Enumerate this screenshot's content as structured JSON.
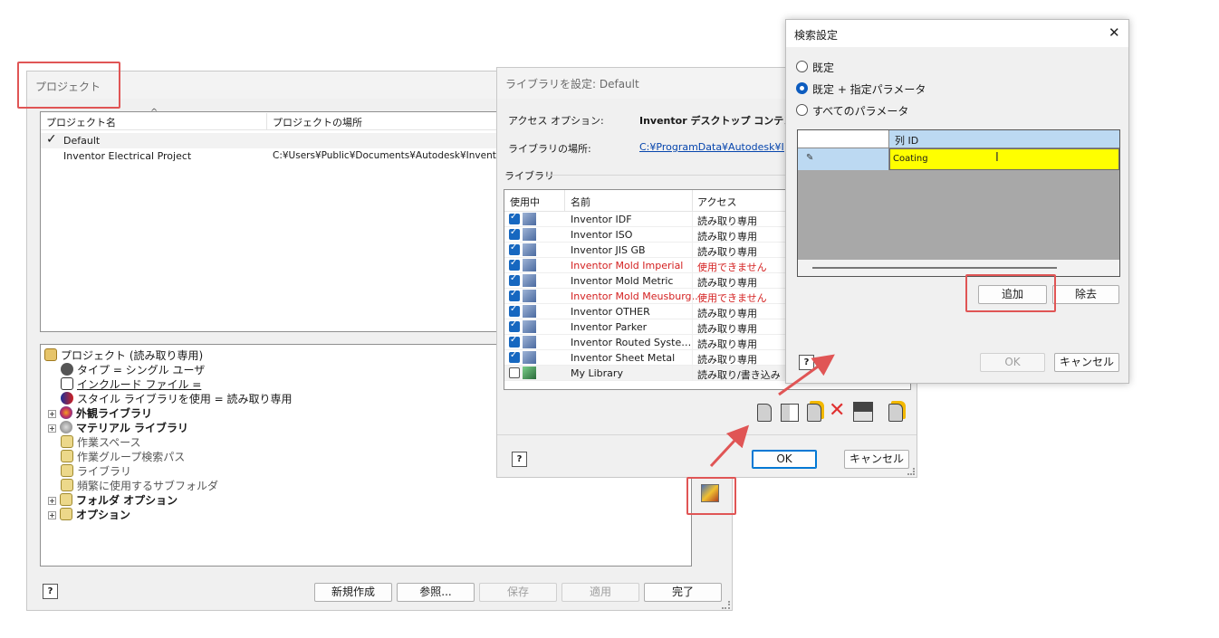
{
  "project_dialog": {
    "title": "プロジェクト",
    "columns": [
      "プロジェクト名",
      "プロジェクトの場所"
    ],
    "projects": [
      {
        "check": "✓",
        "name": "Default",
        "location": ""
      },
      {
        "check": "",
        "name": "Inventor Electrical Project",
        "location": "C:¥Users¥Public¥Documents¥Autodesk¥Inventor"
      }
    ],
    "tree": {
      "root": "プロジェクト (読み取り専用)",
      "type": "タイプ = シングル ユーザ",
      "include": "インクルード ファイル =",
      "style": "スタイル ライブラリを使用 = 読み取り専用",
      "appearance": "外観ライブラリ",
      "material": "マテリアル ライブラリ",
      "workspace": "作業スペース",
      "workgroup": "作業グループ検索パス",
      "libraries": "ライブラリ",
      "subfolders": "頻繁に使用するサブフォルダ",
      "folder_options": "フォルダ オプション",
      "options": "オプション"
    },
    "buttons": {
      "new": "新規作成",
      "browse": "参照...",
      "save": "保存",
      "apply": "適用",
      "done": "完了"
    }
  },
  "library_dialog": {
    "title": "ライブラリを設定: Default",
    "access_label": "アクセス オプション:",
    "access_value": "Inventor デスクトップ コンテンツ",
    "location_label": "ライブラリの場所:",
    "location_value": "C:¥ProgramData¥Autodesk¥Inve",
    "group_label": "ライブラリ",
    "columns": [
      "使用中",
      "名前",
      "アクセス"
    ],
    "rows": [
      {
        "checked": true,
        "name": "Inventor IDF",
        "access": "読み取り専用",
        "error": false
      },
      {
        "checked": true,
        "name": "Inventor ISO",
        "access": "読み取り専用",
        "error": false
      },
      {
        "checked": true,
        "name": "Inventor JIS GB",
        "access": "読み取り専用",
        "error": false
      },
      {
        "checked": true,
        "name": "Inventor Mold Imperial",
        "access": "使用できません",
        "error": true
      },
      {
        "checked": true,
        "name": "Inventor Mold Metric",
        "access": "読み取り専用",
        "error": false
      },
      {
        "checked": true,
        "name": "Inventor Mold Meusburg…",
        "access": "使用できません",
        "error": true
      },
      {
        "checked": true,
        "name": "Inventor OTHER",
        "access": "読み取り専用",
        "error": false
      },
      {
        "checked": true,
        "name": "Inventor Parker",
        "access": "読み取り専用",
        "error": false
      },
      {
        "checked": true,
        "name": "Inventor Routed Syste…",
        "access": "読み取り専用",
        "error": false
      },
      {
        "checked": true,
        "name": "Inventor Sheet Metal",
        "access": "読み取り専用",
        "error": false
      },
      {
        "checked": false,
        "name": "My Library",
        "access": "読み取り/書き込み",
        "error": false
      }
    ],
    "buttons": {
      "ok": "OK",
      "cancel": "キャンセル"
    },
    "colors": {
      "error": "#d42020",
      "link": "#0645ad"
    }
  },
  "search_dialog": {
    "title": "検索設定",
    "radios": [
      {
        "label": "既定",
        "selected": false
      },
      {
        "label": "既定 + 指定パラメータ",
        "selected": true
      },
      {
        "label": "すべてのパラメータ",
        "selected": false
      }
    ],
    "grid_header": "列 ID",
    "grid_value": "Coating",
    "buttons": {
      "add": "追加",
      "remove": "除去",
      "ok": "OK",
      "cancel": "キャンセル"
    },
    "colors": {
      "selected_cell": "#ffff00",
      "header": "#bcd9f2"
    }
  },
  "icons": {
    "help": "?",
    "close": "✕",
    "sort_arrow": "^"
  }
}
